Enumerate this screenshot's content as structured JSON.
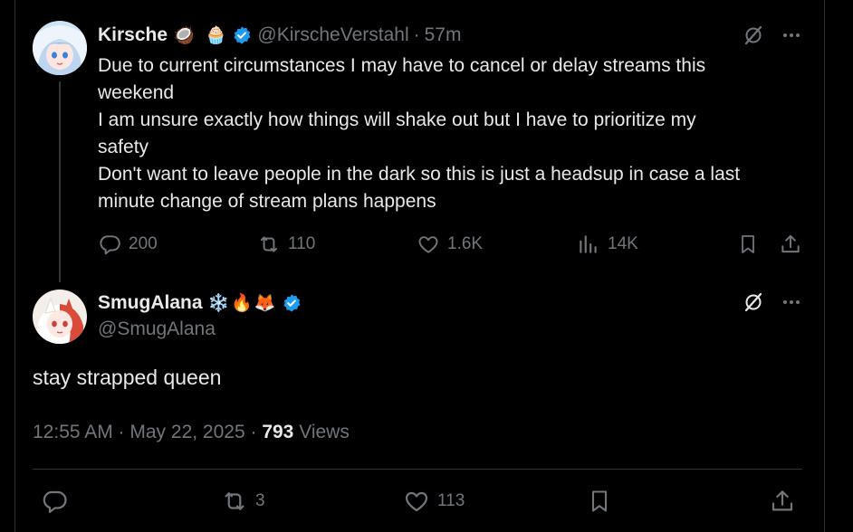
{
  "tweet": {
    "display_name": "Kirsche",
    "emojis": [
      "🥥",
      "🧁"
    ],
    "handle": "@KirscheVerstahl",
    "time": "57m",
    "text_lines": [
      "Due to current circumstances I may have to cancel or delay streams this",
      "weekend",
      "I am unsure exactly how things will shake out but I have to prioritize my",
      "safety",
      "Don't want to leave people in the dark so this is just a headsup in case a last",
      "minute change of stream plans happens"
    ],
    "stats": {
      "replies": "200",
      "reposts": "110",
      "likes": "1.6K",
      "views": "14K"
    }
  },
  "reply": {
    "display_name": "SmugAlana",
    "emojis": [
      "❄️",
      "🔥",
      "🦊"
    ],
    "handle": "@SmugAlana",
    "text": "stay strapped queen",
    "timestamp": "12:55 AM · May 22, 2025",
    "view_count": "793",
    "views_label": "Views",
    "stats": {
      "reposts": "3",
      "likes": "113"
    }
  },
  "colors": {
    "background": "#000000",
    "text_primary": "#e7e9ea",
    "text_secondary": "#71767b",
    "verified": "#1d9bf0",
    "divider": "#2f3336"
  },
  "icons": {
    "verified": "verified-badge-icon",
    "grok": "grok-icon",
    "more": "more-icon",
    "reply": "reply-icon",
    "repost": "repost-icon",
    "like": "like-icon",
    "views": "views-icon",
    "bookmark": "bookmark-icon",
    "share": "share-icon"
  }
}
